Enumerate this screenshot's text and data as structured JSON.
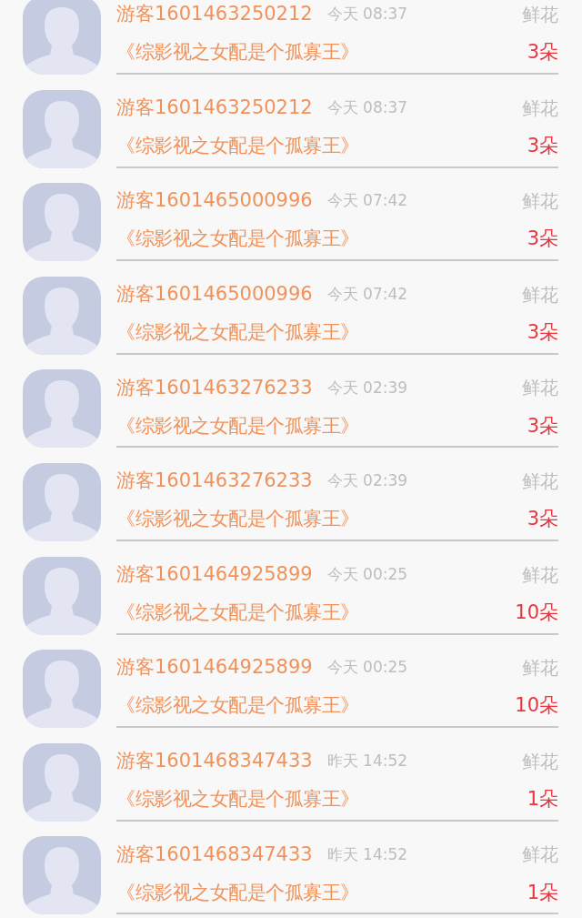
{
  "records": [
    {
      "user": "游客1601463250212",
      "time": "今天 08:37",
      "gift": "鲜花",
      "book": "《综影视之女配是个孤寡王》",
      "count": "3朵"
    },
    {
      "user": "游客1601463250212",
      "time": "今天 08:37",
      "gift": "鲜花",
      "book": "《综影视之女配是个孤寡王》",
      "count": "3朵"
    },
    {
      "user": "游客1601465000996",
      "time": "今天 07:42",
      "gift": "鲜花",
      "book": "《综影视之女配是个孤寡王》",
      "count": "3朵"
    },
    {
      "user": "游客1601465000996",
      "time": "今天 07:42",
      "gift": "鲜花",
      "book": "《综影视之女配是个孤寡王》",
      "count": "3朵"
    },
    {
      "user": "游客1601463276233",
      "time": "今天 02:39",
      "gift": "鲜花",
      "book": "《综影视之女配是个孤寡王》",
      "count": "3朵"
    },
    {
      "user": "游客1601463276233",
      "time": "今天 02:39",
      "gift": "鲜花",
      "book": "《综影视之女配是个孤寡王》",
      "count": "3朵"
    },
    {
      "user": "游客1601464925899",
      "time": "今天 00:25",
      "gift": "鲜花",
      "book": "《综影视之女配是个孤寡王》",
      "count": "10朵"
    },
    {
      "user": "游客1601464925899",
      "time": "今天 00:25",
      "gift": "鲜花",
      "book": "《综影视之女配是个孤寡王》",
      "count": "10朵"
    },
    {
      "user": "游客1601468347433",
      "time": "昨天 14:52",
      "gift": "鲜花",
      "book": "《综影视之女配是个孤寡王》",
      "count": "1朵"
    },
    {
      "user": "游客1601468347433",
      "time": "昨天 14:52",
      "gift": "鲜花",
      "book": "《综影视之女配是个孤寡王》",
      "count": "1朵"
    }
  ]
}
